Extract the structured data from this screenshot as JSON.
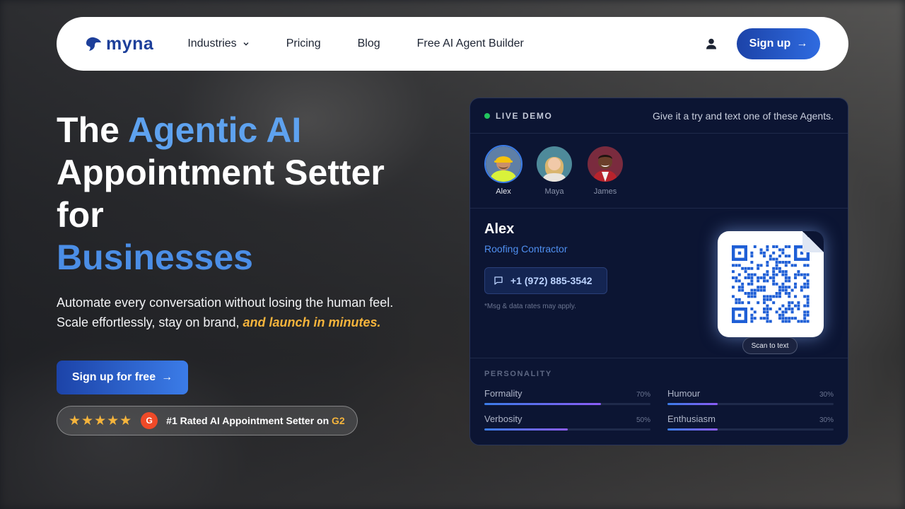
{
  "nav": {
    "logo_text": "myna",
    "links": [
      {
        "label": "Industries"
      },
      {
        "label": "Pricing"
      },
      {
        "label": "Blog"
      },
      {
        "label": "Free AI Agent Builder"
      }
    ],
    "signup_label": "Sign up"
  },
  "hero": {
    "title_part1": "The ",
    "title_accent": "Agentic AI",
    "title_part2": "Appointment Setter",
    "title_part3": "for",
    "title_accent2": "Businesses",
    "subtitle_line1": "Automate every conversation without losing the human feel.",
    "subtitle_line2": "Scale effortlessly, stay on brand, ",
    "subtitle_highlight": "and launch in minutes.",
    "cta_label": "Sign up for free",
    "rating_stars": "★★★★★",
    "g2_badge": "G",
    "rating_text": "#1 Rated AI Appointment Setter on ",
    "rating_g2": "G2"
  },
  "demo": {
    "live_label": "LIVE DEMO",
    "hint": "Give it a try and text one of these Agents.",
    "agents": [
      {
        "name": "Alex",
        "active": true
      },
      {
        "name": "Maya",
        "active": false
      },
      {
        "name": "James",
        "active": false
      }
    ],
    "selected": {
      "name": "Alex",
      "role": "Roofing Contractor",
      "phone": "+1 (972) 885-3542",
      "disclaimer": "*Msg & data rates may apply.",
      "scan_label": "Scan to text"
    },
    "personality_title": "PERSONALITY",
    "traits": [
      {
        "label": "Formality",
        "value": "70%",
        "level": 0.7
      },
      {
        "label": "Humour",
        "value": "30%",
        "level": 0.3
      },
      {
        "label": "Verbosity",
        "value": "50%",
        "level": 0.5
      },
      {
        "label": "Enthusiasm",
        "value": "30%",
        "level": 0.3
      }
    ]
  },
  "colors": {
    "brand": "#1d3f9a",
    "accent": "#5ea2ef",
    "highlight": "#f5b43c",
    "card_bg": "#0c1533",
    "live": "#22c55e"
  }
}
